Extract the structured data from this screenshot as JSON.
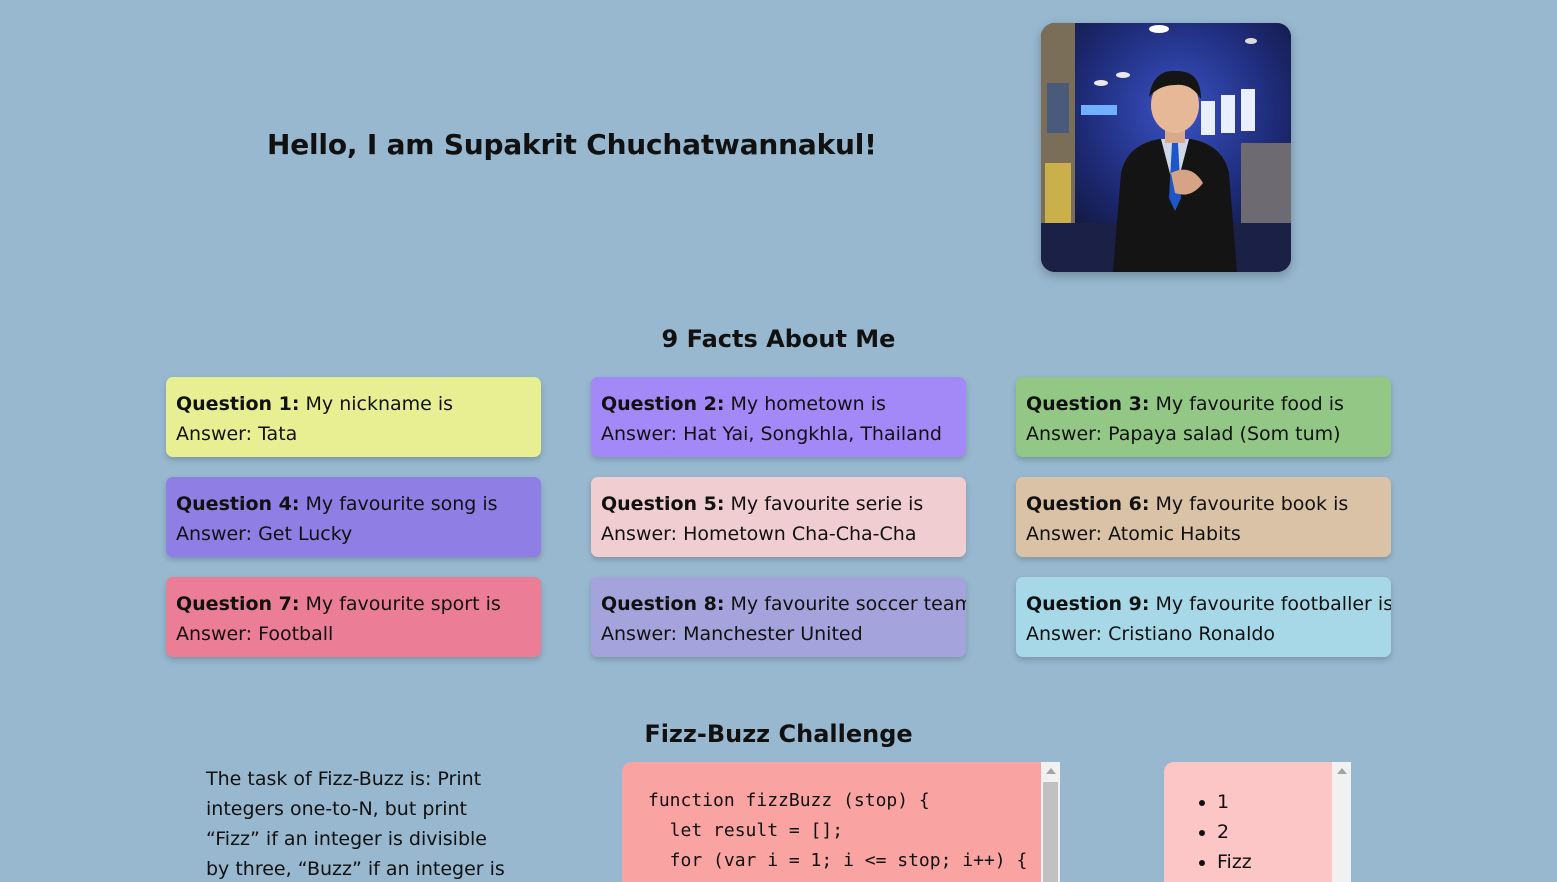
{
  "hero": {
    "title": "Hello, I am Supakrit Chuchatwannakul!"
  },
  "facts": {
    "title": "9 Facts About Me",
    "cards": [
      {
        "question": "Question 1:",
        "prompt": "My nickname is",
        "answer": "Answer: Tata",
        "color": "#e8ef93"
      },
      {
        "question": "Question 2:",
        "prompt": "My hometown is",
        "answer": "Answer: Hat Yai, Songkhla, Thailand",
        "color": "#a388f8"
      },
      {
        "question": "Question 3:",
        "prompt": "My favourite food is",
        "answer": "Answer: Papaya salad (Som tum)",
        "color": "#93c786"
      },
      {
        "question": "Question 4:",
        "prompt": "My favourite song is",
        "answer": "Answer: Get Lucky",
        "color": "#8f7ee3"
      },
      {
        "question": "Question 5:",
        "prompt": "My favourite serie is",
        "answer": "Answer: Hometown Cha-Cha-Cha",
        "color": "#f0cdd0"
      },
      {
        "question": "Question 6:",
        "prompt": "My favourite book is",
        "answer": "Answer: Atomic Habits",
        "color": "#d9c2a6"
      },
      {
        "question": "Question 7:",
        "prompt": "My favourite sport is",
        "answer": "Answer: Football",
        "color": "#ec7d96"
      },
      {
        "question": "Question 8:",
        "prompt": "My favourite soccer team is",
        "answer": "Answer: Manchester United",
        "color": "#a5a3db"
      },
      {
        "question": "Question 9:",
        "prompt": "My favourite footballer is",
        "answer": "Answer: Cristiano Ronaldo",
        "color": "#a6d8e7"
      }
    ]
  },
  "fizzbuzz": {
    "title": "Fizz-Buzz Challenge",
    "description": "The task of Fizz-Buzz is: Print integers one-to-N, but print “Fizz” if an integer is divisible by three, “Buzz” if an integer is divisible by",
    "code_lines": [
      "function fizzBuzz (stop) {",
      "  let result = [];",
      "  for (var i = 1; i <= stop; i++) {"
    ],
    "output_items": [
      "1",
      "2",
      "Fizz"
    ]
  }
}
